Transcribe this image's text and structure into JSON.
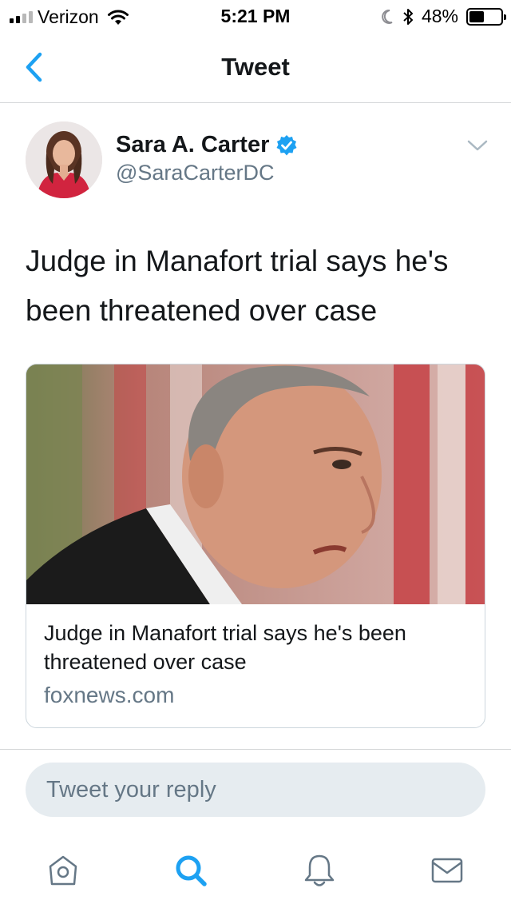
{
  "status_bar": {
    "carrier": "Verizon",
    "time": "5:21 PM",
    "battery": "48%",
    "battery_level": 0.48
  },
  "nav": {
    "title": "Tweet",
    "back_icon": "chevron-left-icon"
  },
  "tweet": {
    "author_name": "Sara A. Carter",
    "author_handle": "@SaraCarterDC",
    "verified": true,
    "text": "Judge in Manafort trial says he's been threatened over case",
    "card": {
      "title": "Judge in Manafort trial says he's been threatened over case",
      "domain": "foxnews.com"
    }
  },
  "reply": {
    "placeholder": "Tweet your reply"
  },
  "tabs": [
    {
      "icon": "home-icon",
      "active": false
    },
    {
      "icon": "search-icon",
      "active": true
    },
    {
      "icon": "bell-icon",
      "active": false
    },
    {
      "icon": "mail-icon",
      "active": false
    }
  ],
  "colors": {
    "accent": "#1da1f2",
    "text": "#14171a",
    "secondary": "#657786",
    "border": "#ccd6dd"
  }
}
